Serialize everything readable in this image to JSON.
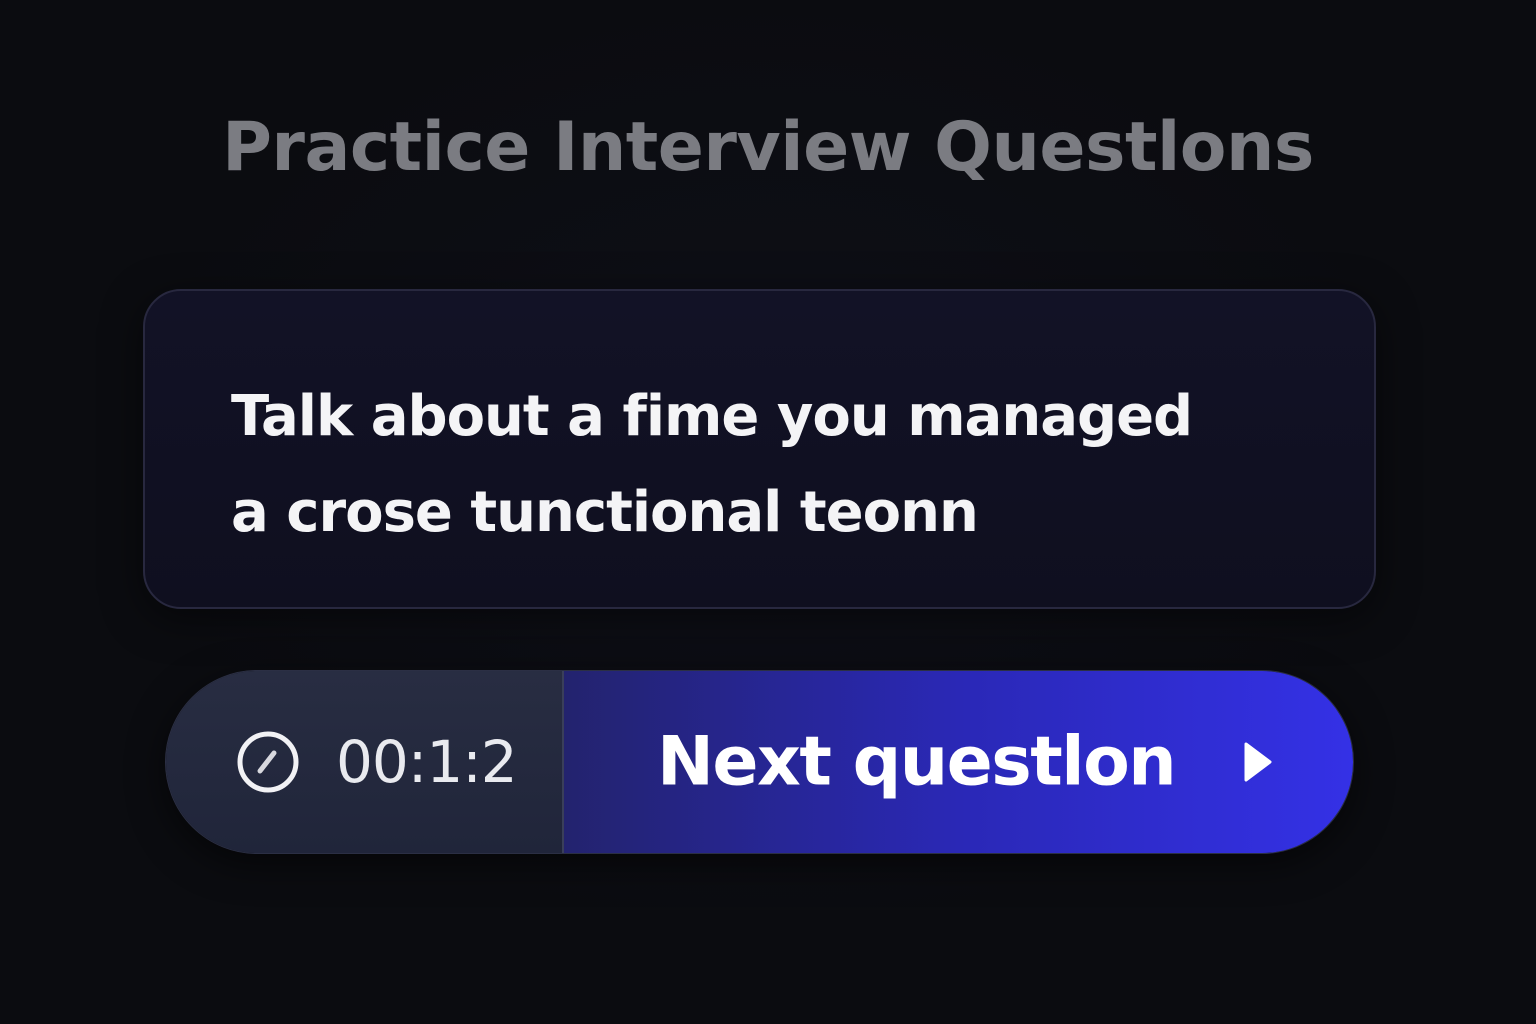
{
  "header": {
    "title": "Practice Interview Questlons"
  },
  "question": {
    "line1": "Talk about a fime you managed",
    "line2": "a crose tunctional teonn"
  },
  "controls": {
    "timer_icon": "timer-icon",
    "timer_value": "00:1:2",
    "next_label": "Next questlon",
    "next_icon": "play-arrow-icon",
    "accent_color": "#3431e6"
  }
}
